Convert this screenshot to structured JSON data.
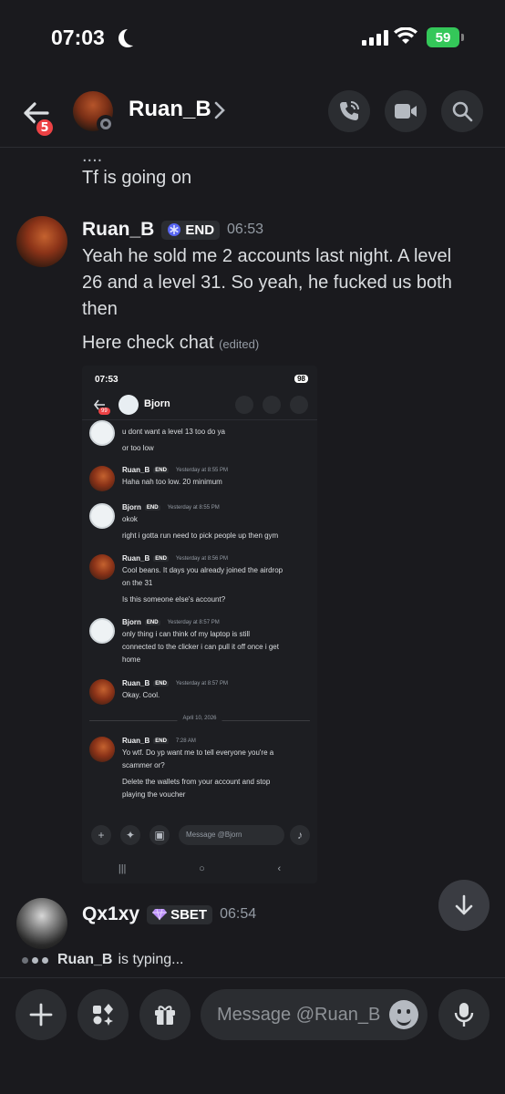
{
  "status_bar": {
    "time": "07:03",
    "battery": "59"
  },
  "header": {
    "unread_count": "5",
    "username": "Ruan_B"
  },
  "messages": {
    "prev_dots": "....",
    "prev_text": "Tf is going on",
    "ruan": {
      "author": "Ruan_B",
      "tag": "END",
      "time": "06:53",
      "lines": [
        "Yeah he sold me 2 accounts last night. A level",
        "26 and a level 31. So yeah, he fucked us both",
        "then"
      ],
      "second": "Here check chat",
      "edited": "(edited)"
    },
    "qx": {
      "author": "Qx1xy",
      "tag": "SBET",
      "time": "06:54"
    }
  },
  "embedded": {
    "time": "07:53",
    "battery": "98",
    "unread": "99",
    "username": "Bjorn",
    "input_placeholder": "Message @Bjorn",
    "date_divider": "April 10, 2026",
    "top_partial": [
      "u dont want a level 13 too do ya",
      "or too low"
    ],
    "msgs": [
      {
        "author": "Ruan_B",
        "tag": "END",
        "time": "Yesterday at 8:55 PM",
        "lines": [
          "Haha nah too low. 20 minimum"
        ]
      },
      {
        "author": "Bjorn",
        "tag": "END",
        "time": "Yesterday at 8:55 PM",
        "lines": [
          "okok",
          "right i gotta run need to pick people up then gym"
        ]
      },
      {
        "author": "Ruan_B",
        "tag": "END",
        "time": "Yesterday at 8:56 PM",
        "lines": [
          "Cool beans. It days you already joined the airdrop",
          "on the 31",
          "Is this someone else's account?"
        ]
      },
      {
        "author": "Bjorn",
        "tag": "END",
        "time": "Yesterday at 8:57 PM",
        "lines": [
          "only thing i can think of my laptop is still",
          "connected to the clicker  i can pull it off once i get",
          "home"
        ]
      },
      {
        "author": "Ruan_B",
        "tag": "END",
        "time": "Yesterday at 8:57 PM",
        "lines": [
          "Okay. Cool."
        ]
      },
      {
        "author": "Ruan_B",
        "tag": "END",
        "time": "7:28 AM",
        "lines": [
          "Yo wtf. Do yp want me to tell everyone you're a",
          "scammer or?",
          "Delete the wallets from your account and stop",
          "playing the voucher"
        ]
      }
    ]
  },
  "typing": {
    "user": "Ruan_B",
    "suffix": "is typing..."
  },
  "composer": {
    "placeholder": "Message @Ruan_B"
  },
  "icons": [
    "back-icon",
    "phone-icon",
    "video-icon",
    "search-icon",
    "plus-icon",
    "apps-icon",
    "gift-icon",
    "emoji-icon",
    "mic-icon",
    "arrow-down-icon"
  ],
  "colors": {
    "background": "#1a1a1e",
    "badge_red": "#ed4245",
    "battery_green": "#34c759",
    "end_tag_blue": "#5865f2",
    "sbet_purple": "#b98cf7"
  }
}
